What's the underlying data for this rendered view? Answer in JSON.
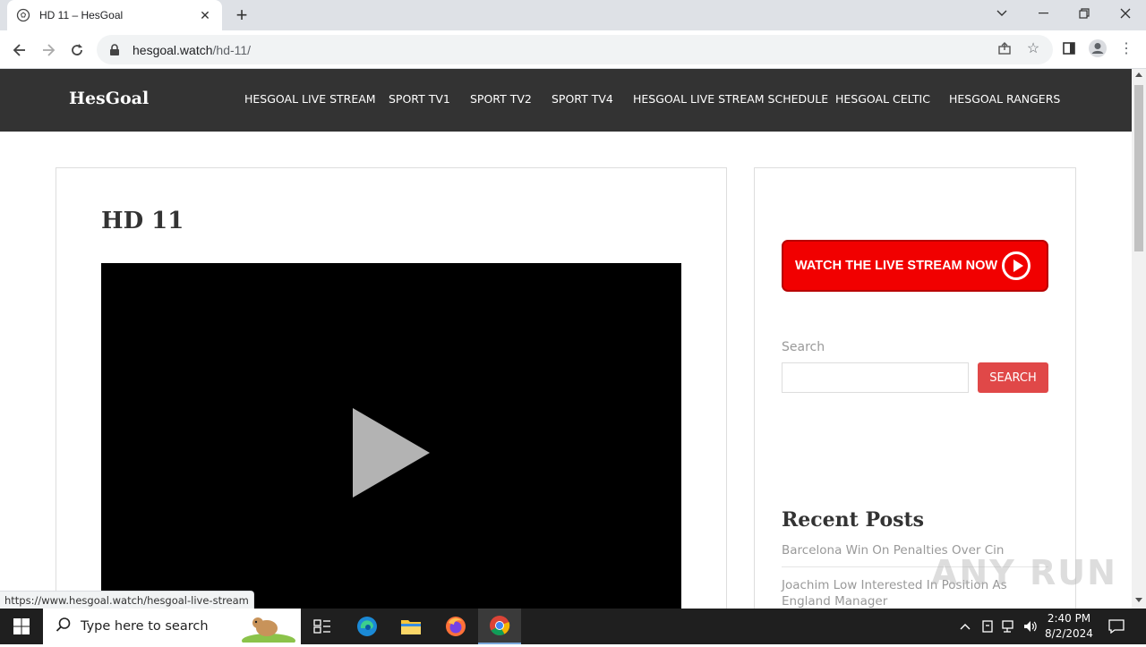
{
  "browser": {
    "tab_title": "HD 11 – HesGoal",
    "url_domain": "hesgoal.watch",
    "url_path": "/hd-11/",
    "status_url": "https://www.hesgoal.watch/hesgoal-live-stream"
  },
  "site": {
    "logo": "HesGoal",
    "nav": [
      "HESGOAL LIVE STREAM",
      "SPORT TV1",
      "SPORT TV2",
      "SPORT TV4",
      "HESGOAL LIVE STREAM SCHEDULE",
      "HESGOAL CELTIC",
      "HESGOAL RANGERS"
    ]
  },
  "main": {
    "title": "HD 11"
  },
  "sidebar": {
    "cta_label": "WATCH THE LIVE STREAM NOW",
    "search_label": "Search",
    "search_button": "SEARCH",
    "recent_title": "Recent Posts",
    "posts": [
      "Barcelona Win On Penalties Over Cin",
      "Joachim Low Interested In Position As England Manager"
    ]
  },
  "watermark": "ANY RUN",
  "taskbar": {
    "search_placeholder": "Type here to search",
    "time": "2:40 PM",
    "date": "8/2/2024"
  },
  "colors": {
    "header_bg": "#333333",
    "cta_red": "#f10000",
    "search_button": "#e04848"
  }
}
